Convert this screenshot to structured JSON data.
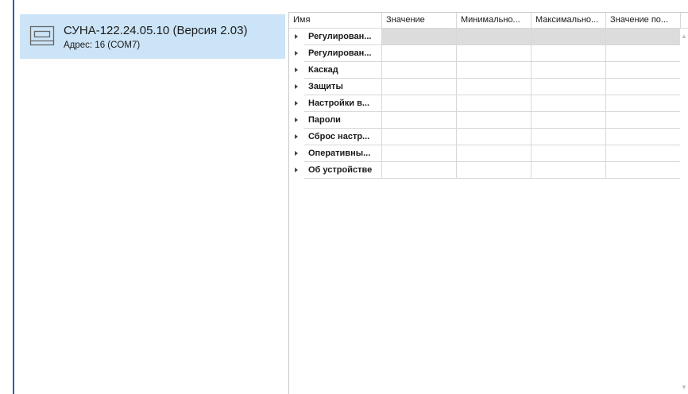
{
  "device": {
    "icon": "device-icon",
    "title": "СУНА-122.24.05.10 (Версия 2.03)",
    "address": "Адрес: 16 (COM7)"
  },
  "grid": {
    "columns": [
      "Имя",
      "Значение",
      "Минимально...",
      "Максимально...",
      "Значение по..."
    ],
    "rows": [
      {
        "name": "Регулирован...",
        "value": "",
        "min": "",
        "max": "",
        "default": ""
      },
      {
        "name": "Регулирован...",
        "value": "",
        "min": "",
        "max": "",
        "default": ""
      },
      {
        "name": "Каскад",
        "value": "",
        "min": "",
        "max": "",
        "default": ""
      },
      {
        "name": "Защиты",
        "value": "",
        "min": "",
        "max": "",
        "default": ""
      },
      {
        "name": "Настройки в...",
        "value": "",
        "min": "",
        "max": "",
        "default": ""
      },
      {
        "name": "Пароли",
        "value": "",
        "min": "",
        "max": "",
        "default": ""
      },
      {
        "name": "Сброс настр...",
        "value": "",
        "min": "",
        "max": "",
        "default": ""
      },
      {
        "name": "Оперативны...",
        "value": "",
        "min": "",
        "max": "",
        "default": ""
      },
      {
        "name": "Об устройстве",
        "value": "",
        "min": "",
        "max": "",
        "default": ""
      }
    ],
    "selected_row": 0
  },
  "colors": {
    "accent_bar": "#2b5fb4",
    "card_selected": "#cce4f7",
    "row_selected": "#dcdcdc"
  }
}
